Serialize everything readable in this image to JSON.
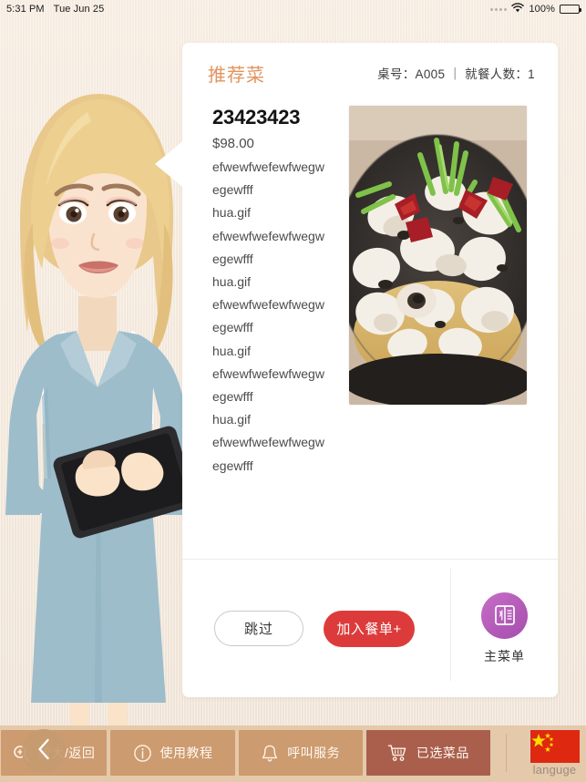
{
  "status_bar": {
    "time": "5:31 PM",
    "date": "Tue Jun 25",
    "wifi_icon": "wifi-icon",
    "battery_percent": "100%",
    "battery_icon": "battery-icon"
  },
  "card": {
    "title": "推荐菜",
    "table_info": "桌号：A005 ｜ 就餐人数：1",
    "dish": {
      "name": "23423423",
      "price": "$98.00",
      "description_lines": [
        "efwewfwefewfwegw",
        "egewfff",
        "hua.gif",
        "efwewfwefewfwegw",
        "egewfff",
        "hua.gif",
        "efwewfwefewfwegw",
        "egewfff",
        "hua.gif",
        "efwewfwefewfwegw",
        "egewfff",
        "hua.gif",
        "efwewfwefewfwegw",
        "egewfff"
      ],
      "photo_alt": "dish-photo-seafood"
    },
    "actions": {
      "skip_label": "跳过",
      "add_label": "加入餐单+",
      "menu_label": "主菜单",
      "menu_icon": "menu-book-icon",
      "add_color": "#dd3b3b",
      "menu_circle_color": "#b35bb8",
      "title_color": "#e2945f"
    }
  },
  "bottom_bar": {
    "back_icon": "chevron-left-icon",
    "items": [
      {
        "label": "放大/返回",
        "icon": "magnifier-plus-icon",
        "active": false
      },
      {
        "label": "使用教程",
        "icon": "info-circle-icon",
        "active": false
      },
      {
        "label": "呼叫服务",
        "icon": "bell-icon",
        "active": false
      },
      {
        "label": "已选菜品",
        "icon": "shopping-cart-icon",
        "active": true
      }
    ],
    "language": {
      "label": "languge",
      "flag_icon": "china-flag-icon"
    },
    "bar_color": "#e5c9ab",
    "button_color": "#cc9b6f",
    "active_button_color": "#a95f4c"
  },
  "avatar": {
    "name": "waitress-illustration"
  }
}
